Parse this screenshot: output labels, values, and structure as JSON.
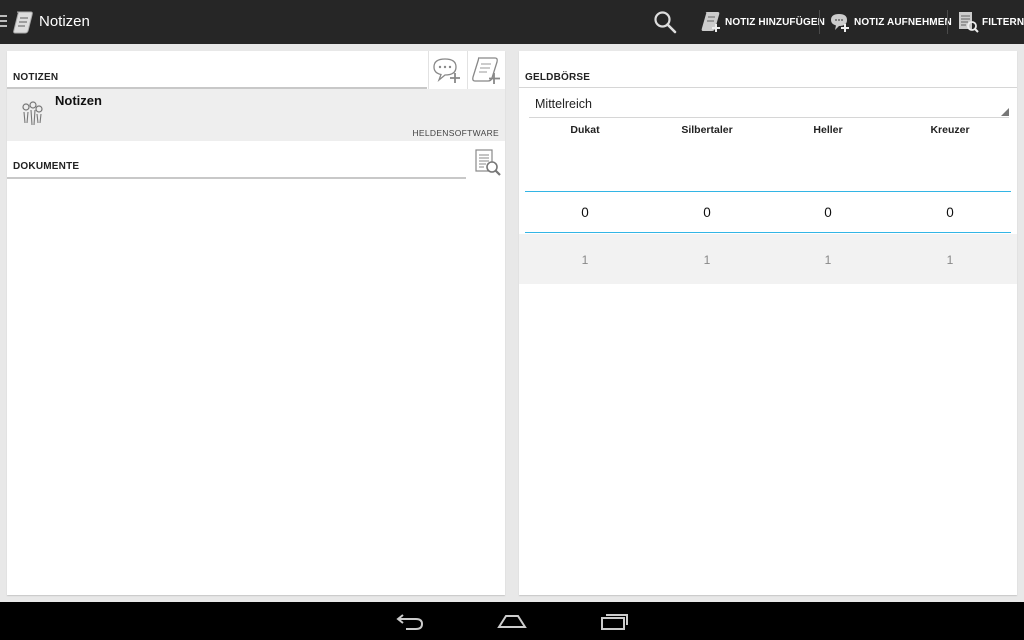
{
  "app": {
    "title": "Notizen",
    "actions": {
      "add_note": "NOTIZ HINZUFÜGEN",
      "record_note": "NOTIZ AUFNEHMEN",
      "filter": "FILTERN"
    }
  },
  "notes": {
    "header": "NOTIZEN",
    "items": [
      {
        "title": "Notizen",
        "author": "HELDENSOFTWARE"
      }
    ]
  },
  "documents": {
    "header": "DOKUMENTE"
  },
  "wallet": {
    "header": "GELDBÖRSE",
    "region": "Mittelreich",
    "columns": [
      "Dukat",
      "Silbertaler",
      "Heller",
      "Kreuzer"
    ],
    "amounts": [
      "0",
      "0",
      "0",
      "0"
    ],
    "rates": [
      "1",
      "1",
      "1",
      "1"
    ],
    "accent_color": "#33b5e5"
  },
  "icons": {
    "app": "scroll-icon",
    "search": "search-icon",
    "add_note": "scroll-add-icon",
    "record_note": "speech-bubble-add-icon",
    "filter": "list-search-icon",
    "note_item": "heroes-icon",
    "nav_back": "back-icon",
    "nav_home": "home-icon",
    "nav_recent": "recent-apps-icon"
  }
}
